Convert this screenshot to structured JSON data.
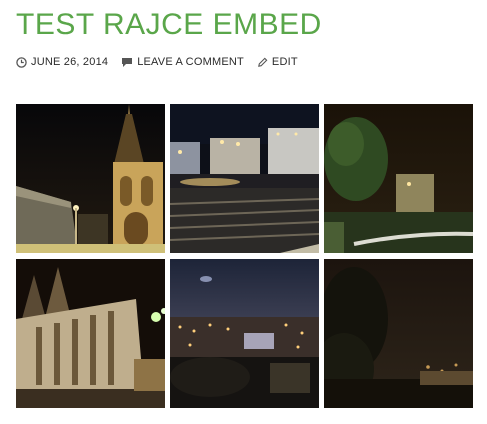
{
  "post": {
    "title": "TEST RAJCE EMBED",
    "date": "JUNE 26, 2014",
    "comment_link": "LEAVE A COMMENT",
    "edit_link": "EDIT"
  },
  "colors": {
    "title": "#5aa64a",
    "meta_text": "#2b2b2b",
    "icon": "#555555"
  },
  "icons": [
    "clock-icon",
    "comment-icon",
    "pencil-icon"
  ],
  "gallery": {
    "photos": [
      {
        "subject": "night church spire with lit facade"
      },
      {
        "subject": "night city square with buildings and railway tracks"
      },
      {
        "subject": "night park with tree and building"
      },
      {
        "subject": "night cathedral with two spires"
      },
      {
        "subject": "night city panorama view"
      },
      {
        "subject": "dark night scene with trees"
      }
    ]
  }
}
